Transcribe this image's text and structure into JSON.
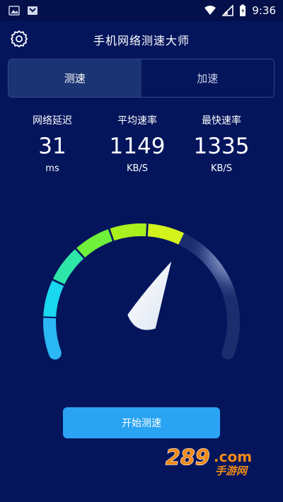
{
  "status_bar": {
    "time": "9:36",
    "icons": [
      "image-icon",
      "gallery-icon",
      "wifi-icon",
      "signal-icon",
      "battery-icon"
    ]
  },
  "header": {
    "title": "手机网络测速大师",
    "settings_icon": "gear-icon"
  },
  "tabs": [
    {
      "label": "测速",
      "active": true
    },
    {
      "label": "加速",
      "active": false
    }
  ],
  "stats": {
    "latency": {
      "label": "网络延迟",
      "value": "31",
      "unit": "ms"
    },
    "average": {
      "label": "平均速率",
      "value": "1149",
      "unit": "KB/S"
    },
    "fastest": {
      "label": "最快速率",
      "value": "1335",
      "unit": "KB/S"
    }
  },
  "gauge": {
    "level": 0.62,
    "colors": [
      "#2bb6f4",
      "#18d7ee",
      "#2ee6a8",
      "#6ff03a",
      "#a8f01e",
      "#d4f21c"
    ]
  },
  "action": {
    "start_label": "开始测速"
  },
  "watermark": {
    "main": "289",
    "suffix": ".com",
    "sub": "手游网"
  }
}
